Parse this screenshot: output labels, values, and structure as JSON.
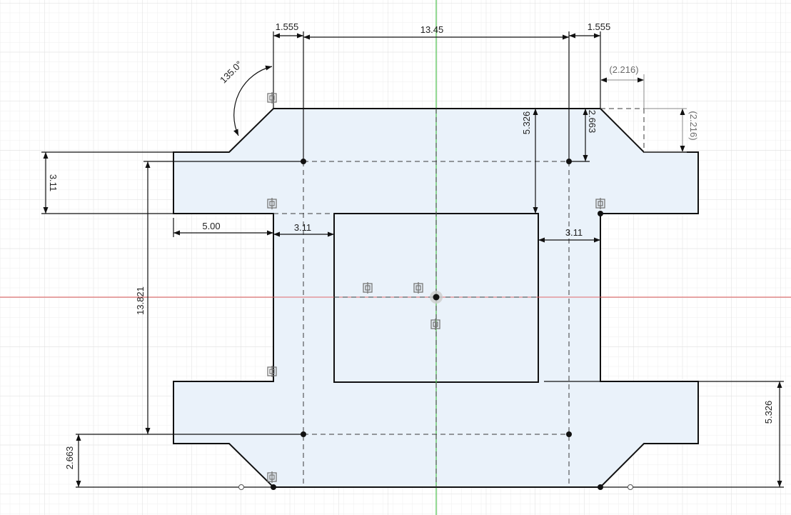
{
  "colors": {
    "background": "#ffffff",
    "grid_minor": "#eeeeee",
    "grid_major": "#dcdcdc",
    "axis_x": "#e05a5a",
    "axis_y": "#4cc24c",
    "profile_fill": "#eaf2fa",
    "line": "#111111"
  },
  "dimensions": {
    "top_left_width": "1.555",
    "top_center_width": "13.45",
    "top_right_width": "1.555",
    "angle": "135.0°",
    "chamfer_h_ref": "(2.216)",
    "chamfer_v_ref": "(2.216)",
    "right_height_5326": "5.326",
    "right_height_2663": "2.663",
    "left_tab_height": "3.11",
    "left_tab_width": "5.00",
    "inner_left_gap": "3.11",
    "inner_right_gap": "3.11",
    "center_height": "13.821",
    "bottom_left_height": "2.663",
    "bottom_right_height": "5.326"
  },
  "icons": {
    "constraint": "coincident-constraint-icon",
    "origin": "origin-point-icon"
  }
}
